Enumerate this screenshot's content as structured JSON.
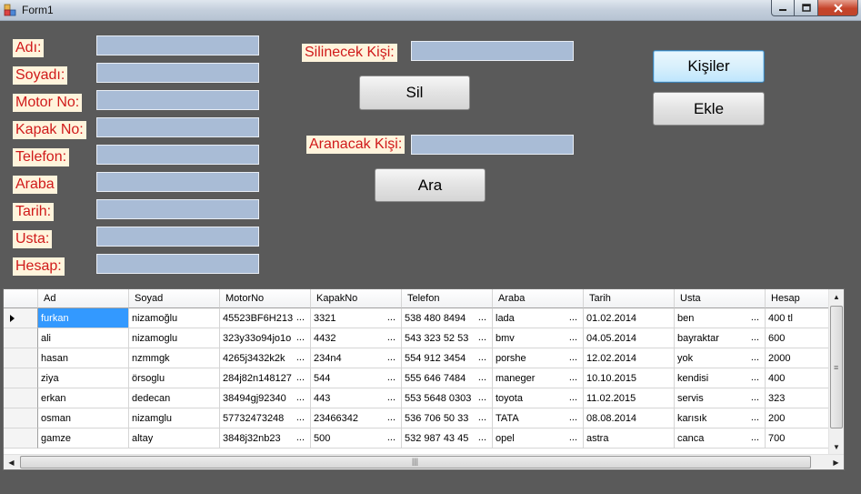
{
  "window": {
    "title": "Form1"
  },
  "labels": {
    "ad": "Adı:",
    "soyad": "Soyadı:",
    "motor": "Motor No:",
    "kapak": "Kapak No:",
    "telefon": "Telefon:",
    "araba": "Araba",
    "tarih": "Tarih:",
    "usta": "Usta:",
    "hesap": "Hesap:",
    "silinecek": "Silinecek Kişi:",
    "aranacak": "Aranacak Kişi:"
  },
  "inputs": {
    "ad": "",
    "soyad": "",
    "motor": "",
    "kapak": "",
    "telefon": "",
    "araba": "",
    "tarih": "",
    "usta": "",
    "hesap": "",
    "silinecek": "",
    "aranacak": ""
  },
  "buttons": {
    "kisiler": "Kişiler",
    "ekle": "Ekle",
    "sil": "Sil",
    "ara": "Ara"
  },
  "grid": {
    "columns": [
      "Ad",
      "Soyad",
      "MotorNo",
      "KapakNo",
      "Telefon",
      "Araba",
      "Tarih",
      "Usta",
      "Hesap"
    ],
    "rows": [
      [
        "furkan",
        "nizamoğlu",
        "45523BF6H213",
        "3321",
        "538 480 8494",
        "lada",
        "01.02.2014",
        "ben",
        "400 tl"
      ],
      [
        "ali",
        "nizamoglu",
        "323y33o94jo1o",
        "4432",
        "543 323 52 53",
        "bmv",
        "04.05.2014",
        "bayraktar",
        "600"
      ],
      [
        "hasan",
        "nzmmgk",
        "4265j3432k2k",
        "234n4",
        "554 912 3454",
        "porshe",
        "12.02.2014",
        "yok",
        "2000"
      ],
      [
        "ziya",
        "örsoglu",
        "284j82n148127",
        "544",
        "555 646 7484",
        "maneger",
        "10.10.2015",
        "kendisi",
        "400"
      ],
      [
        "erkan",
        "dedecan",
        "38494gj92340",
        "443",
        "553 5648 0303",
        "toyota",
        "11.02.2015",
        " servis",
        "323"
      ],
      [
        "osman",
        "nizamglu",
        "57732473248",
        "23466342",
        "536 706 50 33",
        "TATA",
        "08.08.2014",
        "karısık",
        "200"
      ],
      [
        "gamze",
        "altay",
        "3848j32nb23",
        "500",
        "532 987 43 45",
        "opel",
        "astra",
        "canca",
        "700"
      ]
    ]
  }
}
